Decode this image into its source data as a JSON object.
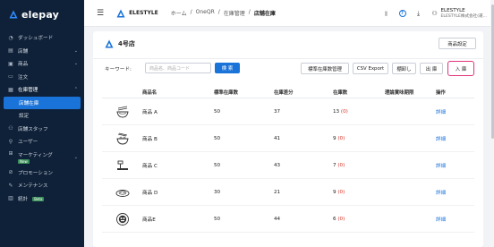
{
  "brand": {
    "name": "elepay"
  },
  "sidebar": {
    "items": [
      {
        "label": "ダッシュボード",
        "icon": "dashboard-icon"
      },
      {
        "label": "店舗",
        "icon": "store-icon",
        "chevron": true
      },
      {
        "label": "商品",
        "icon": "product-icon",
        "chevron": true
      },
      {
        "label": "注文",
        "icon": "order-icon"
      },
      {
        "label": "在庫管理",
        "icon": "inventory-icon",
        "chevron_up": true
      },
      {
        "label": "店舗在庫",
        "active": true
      },
      {
        "label": "設定"
      },
      {
        "label": "店舗スタッフ",
        "icon": "staff-icon"
      },
      {
        "label": "ユーザー",
        "icon": "user-icon"
      },
      {
        "label": "マーケティング",
        "icon": "marketing-icon",
        "badge": "New",
        "chevron": true
      },
      {
        "label": "プロモーション",
        "icon": "promotion-icon"
      },
      {
        "label": "メンテナンス",
        "icon": "maintenance-icon"
      },
      {
        "label": "統計",
        "icon": "stats-icon",
        "badge": "Beta"
      }
    ]
  },
  "header": {
    "store_name": "ELESTYLE",
    "breadcrumb": [
      "ホーム",
      "OneQR",
      "在庫管理",
      "店舗在庫"
    ],
    "user_name": "ELESTYLE",
    "user_company": "ELESTYLE株式会社(運..."
  },
  "card": {
    "title": "4号店",
    "settings_button": "商品設定",
    "keyword_label": "キーワード:",
    "keyword_placeholder": "商品名、商品コード",
    "search_button": "検 索",
    "std_stock_button": "標準在庫数管理",
    "csv_button": "CSV Export",
    "stocktake_button": "棚卸し",
    "outbound_button": "出 庫",
    "inbound_button": "入 庫"
  },
  "table": {
    "headers": [
      "商品名",
      "標準在庫数",
      "在庫差分",
      "在庫数",
      "理論賞味期限",
      "操作"
    ],
    "rows": [
      {
        "name": "商品 A",
        "std": "50",
        "diff": "37",
        "stock": "13",
        "delta": "(0)",
        "op": "詳細",
        "icon": "noodle-bowl-icon"
      },
      {
        "name": "商品 B",
        "std": "50",
        "diff": "41",
        "stock": "9",
        "delta": "(0)",
        "op": "詳細",
        "icon": "noodle-bowl-icon"
      },
      {
        "name": "商品 C",
        "std": "50",
        "diff": "43",
        "stock": "7",
        "delta": "(0)",
        "op": "詳細",
        "icon": "spoon-icon"
      },
      {
        "name": "商品 D",
        "std": "30",
        "diff": "21",
        "stock": "9",
        "delta": "(0)",
        "op": "詳細",
        "icon": "dish-icon"
      },
      {
        "name": "商品E",
        "std": "50",
        "diff": "44",
        "stock": "6",
        "delta": "(0)",
        "op": "詳細",
        "icon": "bento-icon"
      }
    ]
  },
  "colors": {
    "sidebar_bg": "#0f2138",
    "accent": "#1a73d9",
    "highlight": "#e0337a",
    "negative": "#d93025"
  }
}
